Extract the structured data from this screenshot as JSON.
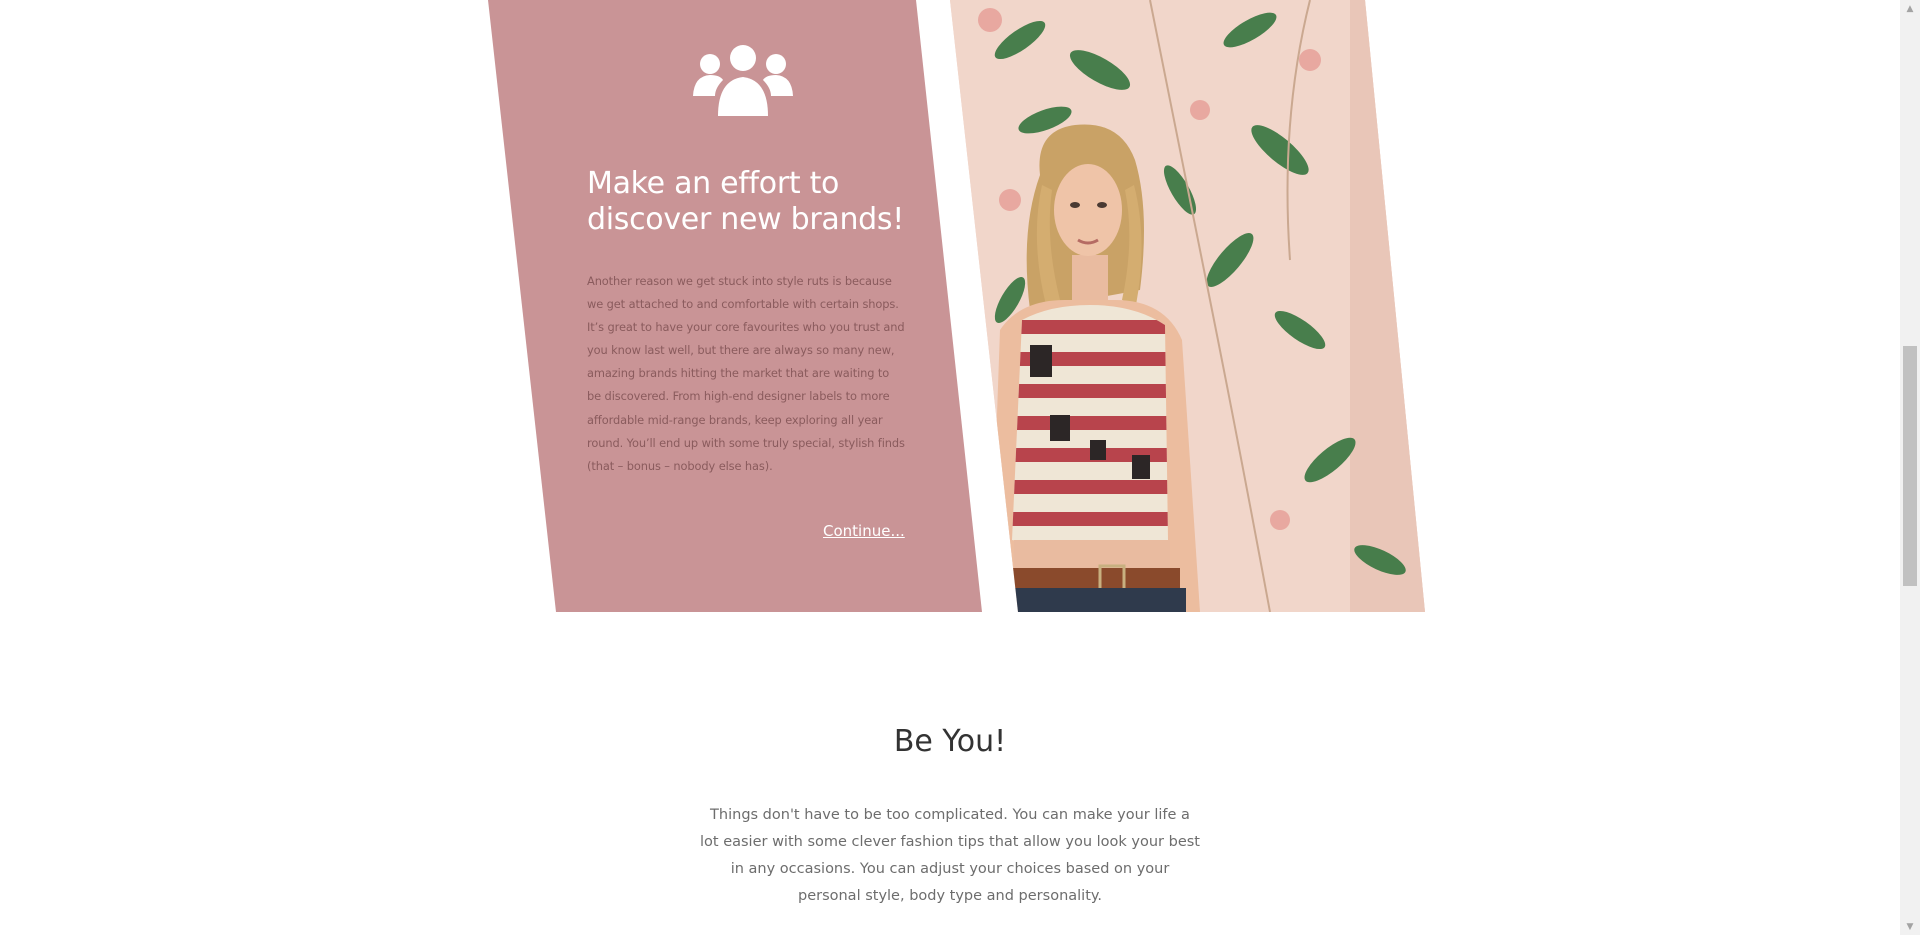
{
  "feature": {
    "icon": "users-icon",
    "title": "Make an effort to discover new brands!",
    "body": "Another reason we get stuck into style ruts is because we get attached to and comfortable with certain shops. It’s great to have your core favourites who you trust and you know last well, but there are always so many new, amazing brands hitting the market that are waiting to be discovered. From high-end designer labels to more affordable mid-range brands, keep exploring all year round. You’ll end up with some truly special, stylish finds (that – bonus – nobody else has).",
    "link_label": "Continue...",
    "photo_alt": "Woman in striped crop top in front of floral wallpaper"
  },
  "section": {
    "title": "Be You!",
    "body": "Things don't have to be too complicated. You can make your life a lot easier with some clever fashion tips that allow you look your best in any occasions. You can adjust your choices based on your personal style, body type and personality."
  },
  "scrollbar": {
    "up_arrow": "▲",
    "down_arrow": "▼"
  },
  "colors": {
    "panel": "#c99496",
    "panel_text": "#8a5b5d",
    "heading": "#333333",
    "body_text": "#6d6d6d"
  }
}
